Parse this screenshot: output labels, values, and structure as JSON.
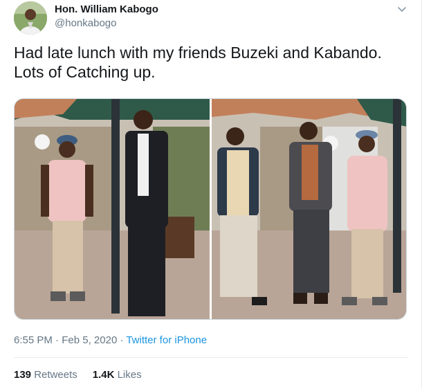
{
  "author": {
    "display_name": "Hon. William Kabogo",
    "handle": "@honkabogo"
  },
  "tweet": {
    "text_line1": "Had late lunch with my friends Buzeki and Kabando.",
    "text_line2": "Lots of Catching up.",
    "time": "6:55 PM",
    "separator1": " · ",
    "date": "Feb 5, 2020",
    "separator2": " · ",
    "source": "Twitter for iPhone"
  },
  "stats": {
    "retweets_count": "139",
    "retweets_label": "Retweets",
    "likes_count": "1.4K",
    "likes_label": "Likes"
  },
  "icons": {
    "menu": "chevron-down-icon"
  },
  "colors": {
    "link": "#1b95e0",
    "muted": "#657786",
    "text": "#14171a",
    "border": "#e6ecf0"
  }
}
